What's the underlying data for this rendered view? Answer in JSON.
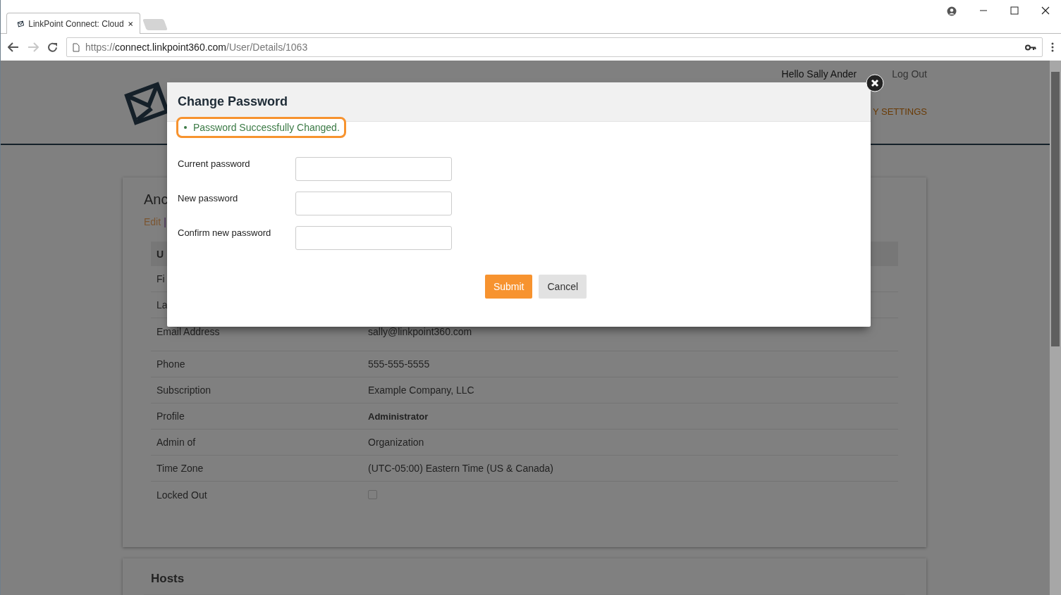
{
  "browser": {
    "tab_title": "LinkPoint Connect: Cloud",
    "url": {
      "scheme": "https://",
      "host": "connect.linkpoint360.com",
      "path": "/User/Details/1063"
    }
  },
  "header": {
    "greeting": "Hello Sally Ander",
    "logout": "Log Out",
    "nav_item": "Y SETTINGS"
  },
  "card": {
    "title": "Anc",
    "links": [
      "Edit",
      "|"
    ],
    "table_header": "U",
    "rows": [
      {
        "kind": "text",
        "label": "Fi"
      },
      {
        "kind": "text",
        "label": "La"
      },
      {
        "kind": "text",
        "label": "Email Address",
        "value": "sally@linkpoint360.com"
      },
      {
        "kind": "text",
        "label": "Phone",
        "value": "555-555-5555"
      },
      {
        "kind": "text",
        "label": "Subscription",
        "value": "Example Company, LLC"
      },
      {
        "kind": "strong",
        "label": "Profile",
        "value": "Administrator"
      },
      {
        "kind": "text",
        "label": "Admin of",
        "value": "Organization"
      },
      {
        "kind": "text",
        "label": "Time Zone",
        "value": "(UTC-05:00) Eastern Time (US & Canada)"
      },
      {
        "kind": "checkbox",
        "label": "Locked Out",
        "checked": false
      }
    ]
  },
  "hosts": {
    "title": "Hosts"
  },
  "modal": {
    "title": "Change Password",
    "messages": [
      "Password Successfully Changed."
    ],
    "fields": [
      {
        "label": "Current password"
      },
      {
        "label": "New password"
      },
      {
        "label": "Confirm new password"
      }
    ],
    "buttons": [
      {
        "label": "Submit",
        "kind": "primary"
      },
      {
        "label": "Cancel",
        "kind": "default"
      }
    ]
  }
}
